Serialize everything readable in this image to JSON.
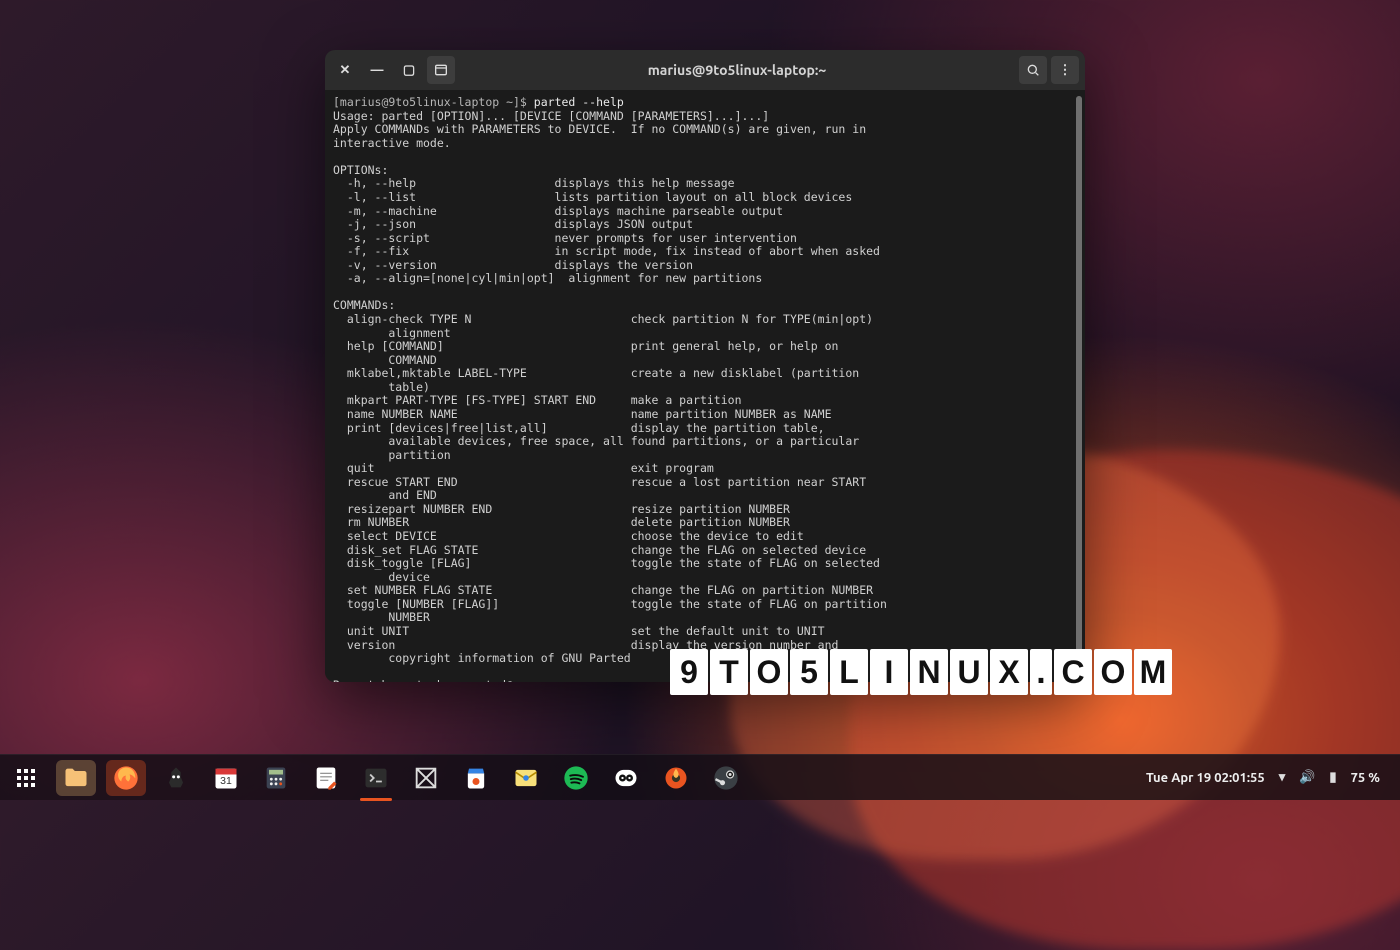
{
  "window": {
    "title": "marius@9to5linux-laptop:~"
  },
  "terminal": {
    "prompt": "[marius@9to5linux-laptop ~]$ ",
    "command": "parted --help",
    "lines": [
      "Usage: parted [OPTION]... [DEVICE [COMMAND [PARAMETERS]...]...]",
      "Apply COMMANDs with PARAMETERS to DEVICE.  If no COMMAND(s) are given, run in",
      "interactive mode.",
      "",
      "OPTIONs:",
      "  -h, --help                    displays this help message",
      "  -l, --list                    lists partition layout on all block devices",
      "  -m, --machine                 displays machine parseable output",
      "  -j, --json                    displays JSON output",
      "  -s, --script                  never prompts for user intervention",
      "  -f, --fix                     in script mode, fix instead of abort when asked",
      "  -v, --version                 displays the version",
      "  -a, --align=[none|cyl|min|opt]  alignment for new partitions",
      "",
      "COMMANDs:",
      "  align-check TYPE N                       check partition N for TYPE(min|opt)",
      "        alignment",
      "  help [COMMAND]                           print general help, or help on",
      "        COMMAND",
      "  mklabel,mktable LABEL-TYPE               create a new disklabel (partition",
      "        table)",
      "  mkpart PART-TYPE [FS-TYPE] START END     make a partition",
      "  name NUMBER NAME                         name partition NUMBER as NAME",
      "  print [devices|free|list,all]            display the partition table,",
      "        available devices, free space, all found partitions, or a particular",
      "        partition",
      "  quit                                     exit program",
      "  rescue START END                         rescue a lost partition near START",
      "        and END",
      "  resizepart NUMBER END                    resize partition NUMBER",
      "  rm NUMBER                                delete partition NUMBER",
      "  select DEVICE                            choose the device to edit",
      "  disk_set FLAG STATE                      change the FLAG on selected device",
      "  disk_toggle [FLAG]                       toggle the state of FLAG on selected",
      "        device",
      "  set NUMBER FLAG STATE                    change the FLAG on partition NUMBER",
      "  toggle [NUMBER [FLAG]]                   toggle the state of FLAG on partition",
      "        NUMBER",
      "  unit UNIT                                set the default unit to UNIT",
      "  version                                  display the version number and",
      "        copyright information of GNU Parted",
      "",
      "Report bugs to bug-parted@gnu.org"
    ]
  },
  "watermark": {
    "text": "9TO5LINUX.COM"
  },
  "dock": {
    "apps": [
      {
        "id": "show-applications",
        "label": "Show Applications"
      },
      {
        "id": "files",
        "label": "Files"
      },
      {
        "id": "firefox",
        "label": "Firefox"
      },
      {
        "id": "hollow-knight",
        "label": "Hollow Knight"
      },
      {
        "id": "calendar",
        "label": "Calendar"
      },
      {
        "id": "calculator",
        "label": "Calculator"
      },
      {
        "id": "text-editor",
        "label": "Text Editor"
      },
      {
        "id": "terminal",
        "label": "Terminal",
        "active": true
      },
      {
        "id": "boxes",
        "label": "Boxes"
      },
      {
        "id": "software",
        "label": "Software"
      },
      {
        "id": "mail",
        "label": "Mail"
      },
      {
        "id": "spotify",
        "label": "Spotify"
      },
      {
        "id": "owl",
        "label": "Chat"
      },
      {
        "id": "obs",
        "label": "Media App"
      },
      {
        "id": "steam",
        "label": "Steam"
      }
    ],
    "datetime": "Tue Apr 19  02:01:55",
    "battery_text": "75 %"
  }
}
